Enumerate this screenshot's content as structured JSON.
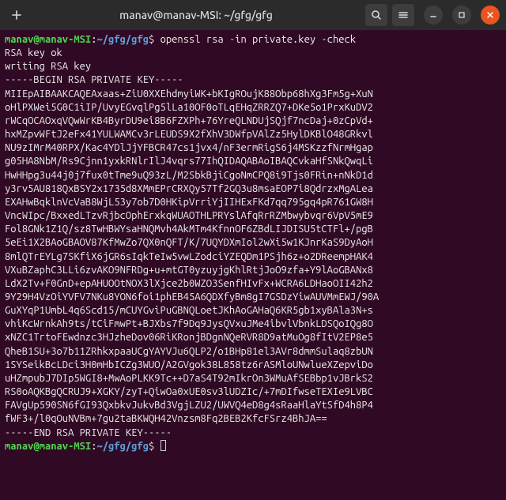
{
  "window": {
    "title": "manav@manav-MSI: ~/gfg/gfg"
  },
  "prompt": {
    "user": "manav@manav-MSI",
    "sep": ":",
    "path": "~/gfg/gfg",
    "sigil": "$"
  },
  "command": "openssl rsa -in private.key -check",
  "output": {
    "status": "RSA key ok",
    "writing": "writing RSA key",
    "begin": "-----BEGIN RSA PRIVATE KEY-----",
    "lines": [
      "MIIEpAIBAAKCAQEAxaas+ZiU0XXEhdmyiWK+bKIgROujK88Obp68hXg3Fm5g+XuN",
      "oHlPXWei5G0C1iIP/UvyEGvqlPg5lLa10OF0oTLqEHqZRRZQ7+DKe5o1PrxKuDV2",
      "rWCqOCAOxqVQwWrKB4ByrDU9ei8B6FZXPh+76YreQLNDUjSQjf7ncDaj+0zCpVd+",
      "hxMZpvWFtJ2eFx41YULWAMCv3rLEUDS9X2fXhV3DWfpVAlZz5HylDKBlO48GRkvl",
      "NU9zIMrM40RPX/Kac4YDlJjYFBCR47cs1jvx4/nF3ermRigS6j4MSKzzfNrmHgap",
      "g05HA8NbM/Rs9Cjnn1yxkRNlrIlJ4vqrs77IhQIDAQABAoIBAQCvkaHfSNkQwqLi",
      "HwHHpg3u44j0j7fux0tTme9uQ93zL/M2SbkBjiCgoNmCPQ8i9Tjs0FRin+nNkD1d",
      "y3rv5AU818QxBSY2x1735d8XMmEPrCRXQy57Tf2GQ3u8msaEOP7i8QdrzxMgALea",
      "EXAHwBqklnVcVaB8WjL53y7ob7D0HKipVrriYjIIHExFKd7qq795gq4pR761GW8H",
      "VncWIpc/BxxedLTzvRjbcOphErxkqWUAOTHLPRYslAfqRrRZMbwybvqr6VpV5mE9",
      "Fol8GNk1Z1Q/sz8TwHBWYsaHNQMvh4AkMTm4KfnnOF6ZBdLIJDISU5tCTFl+/pgB",
      "5eEi1X2BAoGBAOV87KfMwZo7QX0nQFT/K/7UQYDXmIol2wXi5w1KJnrKaS9DyAoH",
      "8mlQTrEYLg7SKfiX6jGR6sIqkTeIw5vwLZodciYZEQDm1PSjh6z+o2DReempHAK4",
      "VXuBZaphC3LLi6zvAKO9NFRDg+u+mtGT0yzuyjgKhlRtjJoO9zfa+Y9lAoGBANx8",
      "LdX2Tv+F0GnD+epAHUOOtNOX3lXjce2b0WZO3SenfHIvFx+WCRA6LDHaoOII42h2",
      "9Y29H4VzOiYVFV7NKu8YON6foi1phEB45A6QDXfyBm8gI7GSDzYiwAUVMmEWJ/90A",
      "GuXYqP1UmbL4q6Scd15/mCUYGviPuGBNQLoetJKhAoGAHaQ6KR5gb1xyBAla3N+s",
      "vhiKcWrnkAh9ts/tCiFmwPt+BJXbs7f9Dq9JysQVxuJMe4ibvlVbnkLDSQoIQg8O",
      "xNZC1TrtoFEwdnzc3HJzheDov06RiKRonjBDgnNQeRVR8D9atMuOg8fItV2EP8e5",
      "QheB1SU+3o7b11ZRhkxpaaUCgYAYVJu6QLP2/o1BHp81el3AVr8dmmSulaq8zbUN",
      "1SYSeikBcLDci3H0mHbICZg3WUO/A2GVgok38L858tz6rASMloUNwlueXZepviDo",
      "uHZmpubJ7DIp5WGI8+MwAoPLKK9Tc++D7aS4T92mIkrOn3WMuAfSEBbp1vJBrkS2",
      "RS0oAQKBgQCRUJ9+XGKY/zyT+QiwOa0xUE0sv3lUDZIc/+7mDIfwseTEXIe9LVBC",
      "FAVgUp590SN6fGI93QxbkvJukvBd3VgjLZU2/UWVQ4eD8g4sRaaHlaYtSfD4h8P4",
      "fWF3+/l0qOuNVBm+7gu2taBKWQH42Vnzsm8Fq2BEB2KfcFSrz4BhJA=="
    ],
    "end": "-----END RSA PRIVATE KEY-----"
  }
}
